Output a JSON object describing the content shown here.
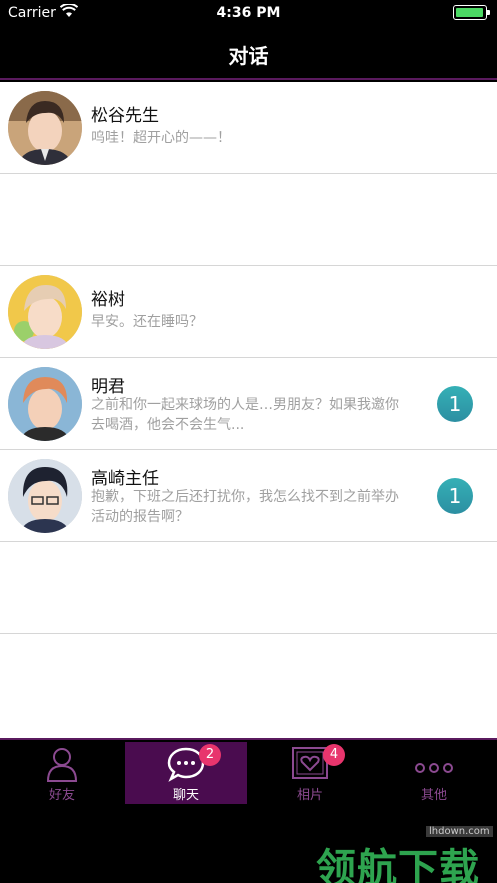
{
  "status_bar": {
    "carrier": "Carrier",
    "time": "4:36 PM",
    "battery_level": 1.0
  },
  "nav": {
    "title": "对话"
  },
  "chats": [
    {
      "name": "松谷先生",
      "message": "呜哇！超开心的——！",
      "unread": ""
    },
    {
      "name": "裕树",
      "message": "早安。还在睡吗？",
      "unread": ""
    },
    {
      "name": "明君",
      "message": "之前和你一起来球场的人是…男朋友？如果我邀你去喝酒，他会不会生气...",
      "unread": "1"
    },
    {
      "name": "高崎主任",
      "message": "抱歉，下班之后还打扰你，我怎么找不到之前举办活动的报告啊？",
      "unread": "1"
    }
  ],
  "tabs": [
    {
      "label": "好友",
      "icon": "person-icon",
      "badge": ""
    },
    {
      "label": "聊天",
      "icon": "chat-bubble-icon",
      "badge": "2"
    },
    {
      "label": "相片",
      "icon": "photo-heart-icon",
      "badge": "4"
    },
    {
      "label": "其他",
      "icon": "more-dots-icon",
      "badge": ""
    }
  ],
  "watermark": {
    "site": "lhdown.com",
    "brand": "领航下载"
  },
  "colors": {
    "accent": "#4a0c4f",
    "badge_teal": "#2f9fac",
    "badge_pink": "#e8356d"
  }
}
